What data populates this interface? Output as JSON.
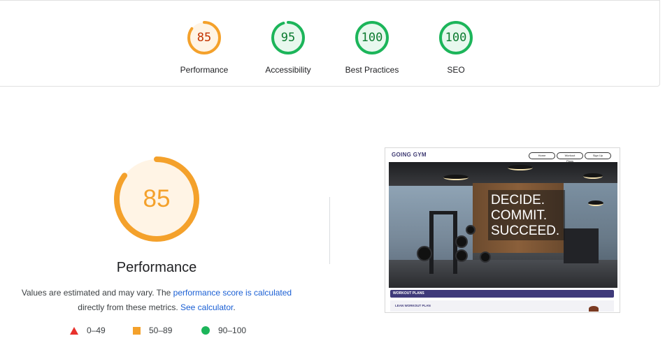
{
  "summary": {
    "categories": [
      {
        "id": "performance",
        "score": "85",
        "label": "Performance",
        "color": "#f4a12b",
        "fill": "#fff4e5",
        "text_color": "#c33300",
        "fraction": 0.85
      },
      {
        "id": "accessibility",
        "score": "95",
        "label": "Accessibility",
        "color": "#1cb55a",
        "fill": "#e8f8ee",
        "text_color": "#0a7a2e",
        "fraction": 0.95
      },
      {
        "id": "best-practices",
        "score": "100",
        "label": "Best Practices",
        "color": "#1cb55a",
        "fill": "#e8f8ee",
        "text_color": "#0a7a2e",
        "fraction": 1.0
      },
      {
        "id": "seo",
        "score": "100",
        "label": "SEO",
        "color": "#1cb55a",
        "fill": "#e8f8ee",
        "text_color": "#0a7a2e",
        "fraction": 1.0
      }
    ]
  },
  "main": {
    "score": "85",
    "fraction": 0.85,
    "title": "Performance",
    "desc_prefix": "Values are estimated and may vary. The ",
    "desc_link1": "performance score is calculated",
    "desc_middle": "directly from these metrics. ",
    "desc_link2": "See calculator",
    "desc_suffix": ".",
    "colors": {
      "ring": "#f4a12b",
      "fill": "#fff4e5"
    }
  },
  "legend": [
    {
      "shape": "triangle",
      "range": "0–49",
      "color": "#e8312c"
    },
    {
      "shape": "square",
      "range": "50–89",
      "color": "#f4a12b"
    },
    {
      "shape": "circle",
      "range": "90–100",
      "color": "#1cb55a"
    }
  ],
  "screenshot": {
    "logo": "GOING GYM",
    "nav": [
      "Home",
      "Workout Plans",
      "Sign Up"
    ],
    "hero_lines": [
      "DECIDE.",
      "COMMIT.",
      "SUCCEED."
    ],
    "section_title": "WORKOUT PLANS",
    "card_title": "LEAN WORKOUT PLAN"
  }
}
